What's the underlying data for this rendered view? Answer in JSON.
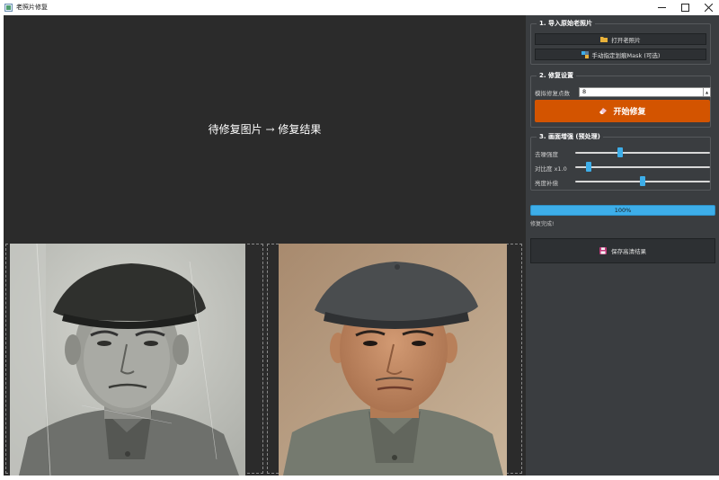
{
  "window": {
    "title": "老照片修复"
  },
  "viewer": {
    "placeholder_text": "待修复图片 → 修复结果",
    "left_image": "original-old-photo",
    "right_image": "restored-photo"
  },
  "import_section": {
    "title": "1. 导入原始老照片",
    "open_button_label": "打开老照片",
    "open_button_icon": "folder-icon",
    "mask_button_label": "手动指定划痕Mask (可选)",
    "mask_button_icon": "brush-icon"
  },
  "repair_section": {
    "title": "2. 修复设置",
    "steps_label": "模拟修复点数",
    "steps_value": "8",
    "start_button_label": "开始修复",
    "start_button_icon": "eraser-icon"
  },
  "enhance_section": {
    "title": "3. 画面增强 (预处理)",
    "sliders": [
      {
        "label": "去噪强度",
        "value": 0.33
      },
      {
        "label": "对比度 x1.0",
        "value": 0.1
      },
      {
        "label": "亮度补偿",
        "value": 0.5
      }
    ]
  },
  "progress": {
    "value": 1.0,
    "text": "100%",
    "status": "修复完成!"
  },
  "save": {
    "label": "保存高清结果",
    "icon": "floppy-disk-icon"
  },
  "colors": {
    "accent": "#3daee9",
    "primary_button": "#d35400",
    "panel_bg": "#3a3d40",
    "viewer_bg": "#2b2b2b"
  }
}
